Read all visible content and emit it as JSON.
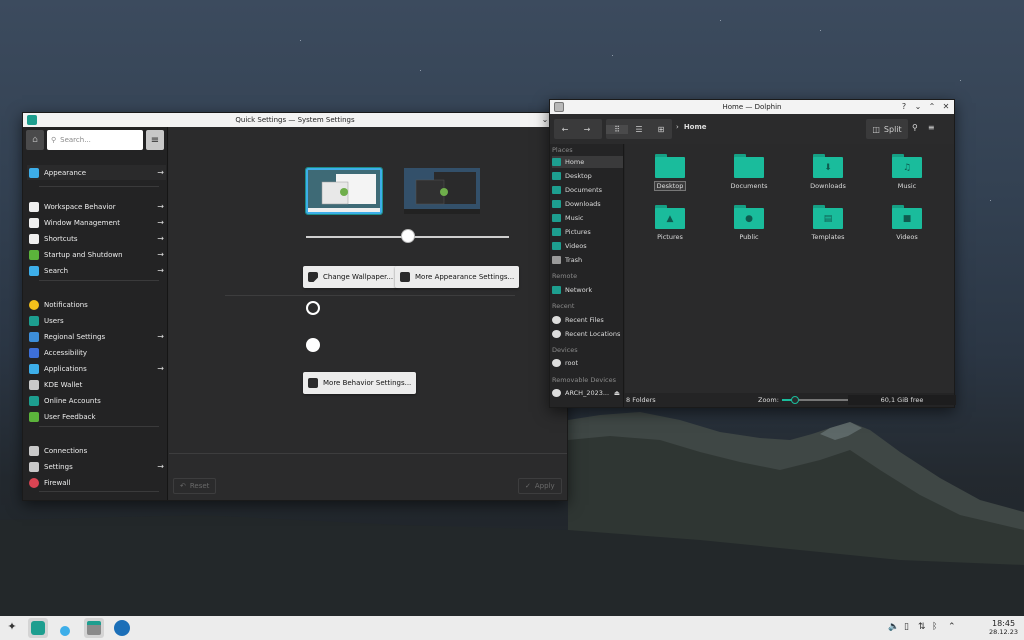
{
  "colors": {
    "accent": "#1abc9c",
    "selection": "#3daee9",
    "warning": "#e5a50a"
  },
  "system_settings": {
    "title": "Quick Settings — System Settings",
    "search_placeholder": "Search...",
    "sidebar": [
      {
        "label": "Appearance",
        "icon": "appearance-icon",
        "arrow": true
      },
      {
        "label": "Workspace Behavior",
        "icon": "workspace-icon",
        "arrow": true
      },
      {
        "label": "Window Management",
        "icon": "window-icon",
        "arrow": true
      },
      {
        "label": "Shortcuts",
        "icon": "keyboard-icon",
        "arrow": true
      },
      {
        "label": "Startup and Shutdown",
        "icon": "startup-icon",
        "arrow": true
      },
      {
        "label": "Search",
        "icon": "search-icon",
        "arrow": true
      },
      {
        "label": "Notifications",
        "icon": "bell-icon",
        "arrow": false
      },
      {
        "label": "Users",
        "icon": "user-icon",
        "arrow": false
      },
      {
        "label": "Regional Settings",
        "icon": "region-icon",
        "arrow": true
      },
      {
        "label": "Accessibility",
        "icon": "accessibility-icon",
        "arrow": false
      },
      {
        "label": "Applications",
        "icon": "applications-icon",
        "arrow": true
      },
      {
        "label": "KDE Wallet",
        "icon": "wallet-icon",
        "arrow": false
      },
      {
        "label": "Online Accounts",
        "icon": "accounts-icon",
        "arrow": false
      },
      {
        "label": "User Feedback",
        "icon": "feedback-icon",
        "arrow": false
      },
      {
        "label": "Connections",
        "icon": "connections-icon",
        "arrow": false
      },
      {
        "label": "Settings",
        "icon": "settings-icon",
        "arrow": true
      },
      {
        "label": "Firewall",
        "icon": "firewall-icon",
        "arrow": false
      }
    ],
    "buttons": {
      "change_wallpaper": "Change Wallpaper...",
      "more_appearance": "More Appearance Settings...",
      "more_behavior": "More Behavior Settings...",
      "reset": "Reset",
      "apply": "Apply"
    },
    "slider_value": 0.5
  },
  "dolphin": {
    "title": "Home — Dolphin",
    "breadcrumb": "Home",
    "split_label": "Split",
    "places_sections": {
      "places": "Places",
      "remote": "Remote",
      "recent": "Recent",
      "devices": "Devices",
      "removable": "Removable Devices"
    },
    "places": [
      "Home",
      "Desktop",
      "Documents",
      "Downloads",
      "Music",
      "Pictures",
      "Videos",
      "Trash"
    ],
    "remote": [
      "Network"
    ],
    "recent": [
      "Recent Files",
      "Recent Locations"
    ],
    "devices": [
      "root"
    ],
    "removable": [
      "ARCH_2023..."
    ],
    "folders": [
      {
        "name": "Desktop",
        "glyph": ""
      },
      {
        "name": "Documents",
        "glyph": ""
      },
      {
        "name": "Downloads",
        "glyph": "⬇"
      },
      {
        "name": "Music",
        "glyph": "♫"
      },
      {
        "name": "Pictures",
        "glyph": "▲"
      },
      {
        "name": "Public",
        "glyph": "●"
      },
      {
        "name": "Templates",
        "glyph": "▤"
      },
      {
        "name": "Videos",
        "glyph": "■"
      }
    ],
    "status": {
      "count": "8 Folders",
      "zoom_label": "Zoom:",
      "free": "60,1 GiB free",
      "zoom_level": 0.2
    }
  },
  "taskbar": {
    "time": "18:45",
    "date": "28.12.23"
  }
}
